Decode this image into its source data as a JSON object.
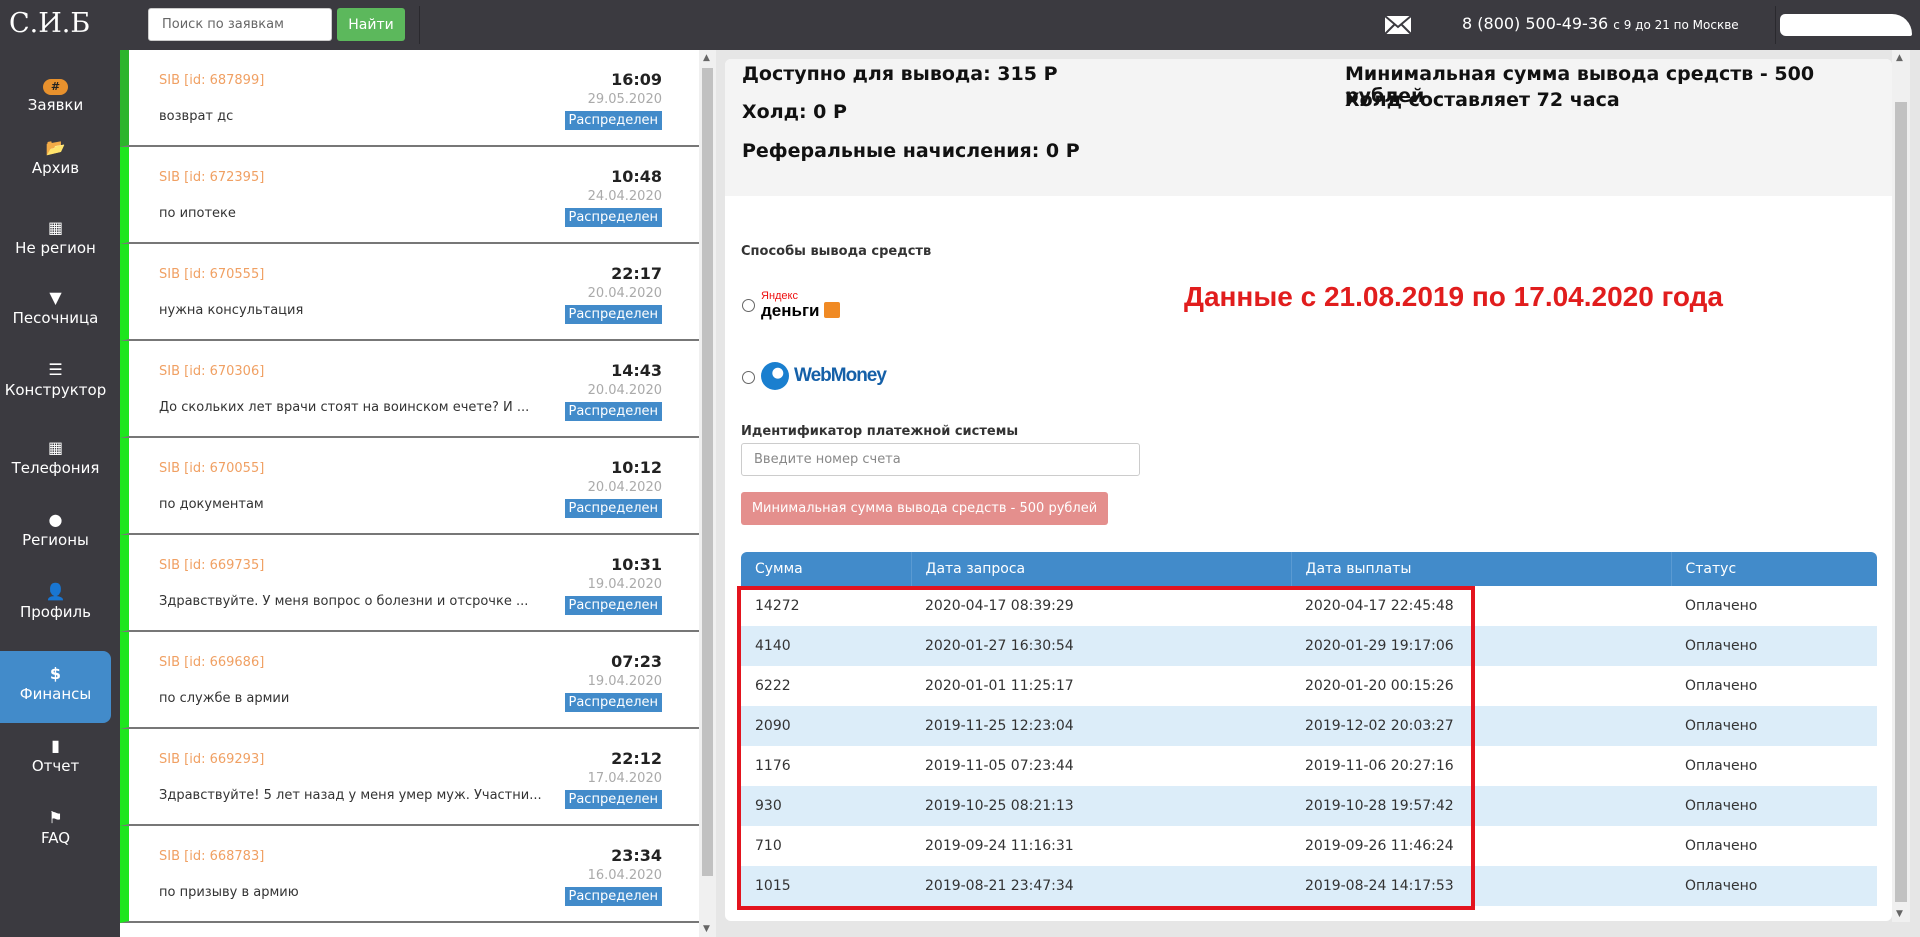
{
  "header": {
    "logo": "С.И.Б",
    "search_placeholder": "Поиск по заявкам",
    "search_button": "Найти",
    "phone": "8 (800) 500-49-36",
    "hours": "с 9 до 21 по Москве"
  },
  "sidebar": {
    "items": [
      {
        "label": "Заявки",
        "icon": "#"
      },
      {
        "label": "Архив",
        "icon": "📂"
      },
      {
        "label": "Не регион",
        "icon": "▦"
      },
      {
        "label": "Песочница",
        "icon": "▼"
      },
      {
        "label": "Конструктор",
        "icon": "☰"
      },
      {
        "label": "Телефония",
        "icon": "▦"
      },
      {
        "label": "Регионы",
        "icon": "●"
      },
      {
        "label": "Профиль",
        "icon": "👤"
      },
      {
        "label": "Финансы",
        "icon": "$"
      },
      {
        "label": "Отчет",
        "icon": "▮"
      },
      {
        "label": "FAQ",
        "icon": "⚑"
      }
    ],
    "active": "Финансы"
  },
  "requests": [
    {
      "id": "SIB [id: 687899]",
      "text": "возврат дс",
      "time": "16:09",
      "date": "29.05.2020",
      "status": "Распределен"
    },
    {
      "id": "SIB [id: 672395]",
      "text": "по ипотеке",
      "time": "10:48",
      "date": "24.04.2020",
      "status": "Распределен"
    },
    {
      "id": "SIB [id: 670555]",
      "text": "нужна консультация",
      "time": "22:17",
      "date": "20.04.2020",
      "status": "Распределен"
    },
    {
      "id": "SIB [id: 670306]",
      "text": "До скольких лет врачи стоят на воинском ечете? И ...",
      "time": "14:43",
      "date": "20.04.2020",
      "status": "Распределен"
    },
    {
      "id": "SIB [id: 670055]",
      "text": "по документам",
      "time": "10:12",
      "date": "20.04.2020",
      "status": "Распределен"
    },
    {
      "id": "SIB [id: 669735]",
      "text": "Здравствуйте. У меня вопрос о болезни и отсрочке ...",
      "time": "10:31",
      "date": "19.04.2020",
      "status": "Распределен"
    },
    {
      "id": "SIB [id: 669686]",
      "text": "по службе в армии",
      "time": "07:23",
      "date": "19.04.2020",
      "status": "Распределен"
    },
    {
      "id": "SIB [id: 669293]",
      "text": "Здравствуйте! 5 лет назад у меня умер муж. Участни...",
      "time": "22:12",
      "date": "17.04.2020",
      "status": "Распределен"
    },
    {
      "id": "SIB [id: 668783]",
      "text": "по призыву в армию",
      "time": "23:34",
      "date": "16.04.2020",
      "status": "Распределен"
    }
  ],
  "finance": {
    "available": "Доступно для вывода: 315 Р",
    "hold": "Холд: 0 Р",
    "referral": "Реферальные начисления: 0 Р",
    "min_info": "Минимальная сумма вывода средств - 500 рублей",
    "hold_info": "Холд составляет 72 часа",
    "methods_label": "Способы вывода средств",
    "yandex_top": "Яндекс",
    "yandex_bottom": "деньги",
    "webmoney": "WebMoney",
    "note": "Данные с 21.08.2019 по 17.04.2020 года",
    "id_label": "Идентификатор платежной системы",
    "id_placeholder": "Введите номер счета",
    "min_button": "Минимальная сумма вывода средств - 500 рублей",
    "columns": [
      "Сумма",
      "Дата запроса",
      "Дата выплаты",
      "Статус"
    ],
    "rows": [
      [
        "14272",
        "2020-04-17 08:39:29",
        "2020-04-17 22:45:48",
        "Оплачено"
      ],
      [
        "4140",
        "2020-01-27 16:30:54",
        "2020-01-29 19:17:06",
        "Оплачено"
      ],
      [
        "6222",
        "2020-01-01 11:25:17",
        "2020-01-20 00:15:26",
        "Оплачено"
      ],
      [
        "2090",
        "2019-11-25 12:23:04",
        "2019-12-02 20:03:27",
        "Оплачено"
      ],
      [
        "1176",
        "2019-11-05 07:23:44",
        "2019-11-06 20:27:16",
        "Оплачено"
      ],
      [
        "930",
        "2019-10-25 08:21:13",
        "2019-10-28 19:57:42",
        "Оплачено"
      ],
      [
        "710",
        "2019-09-24 11:16:31",
        "2019-09-26 11:46:24",
        "Оплачено"
      ],
      [
        "1015",
        "2019-08-21 23:47:34",
        "2019-08-24 14:17:53",
        "Оплачено"
      ]
    ]
  }
}
